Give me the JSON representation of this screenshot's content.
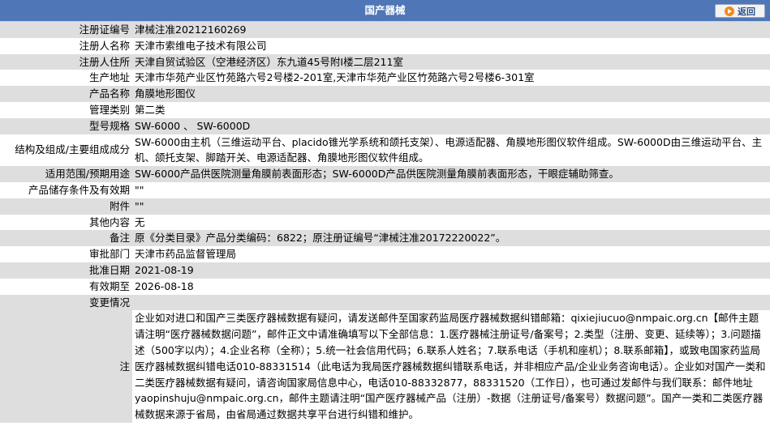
{
  "header": {
    "title": "国产器械",
    "back_label": "返回"
  },
  "rows": [
    {
      "label": "注册证编号",
      "value": "津械注准20212160269"
    },
    {
      "label": "注册人名称",
      "value": "天津市索维电子技术有限公司"
    },
    {
      "label": "注册人住所",
      "value": "天津自贸试验区（空港经济区）东九道45号附Ⅰ楼二层211室"
    },
    {
      "label": "生产地址",
      "value": "天津市华苑产业区竹苑路六号2号楼2-201室,天津市华苑产业区竹苑路六号2号楼6-301室"
    },
    {
      "label": "产品名称",
      "value": "角膜地形图仪"
    },
    {
      "label": "管理类别",
      "value": "第二类"
    },
    {
      "label": "型号规格",
      "value": "SW-6000 、 SW-6000D"
    },
    {
      "label": "结构及组成/主要组成成分",
      "value": "SW-6000由主机（三维运动平台、placido锥光学系统和颌托支架）、电源适配器、角膜地形图仪软件组成。SW-6000D由三维运动平台、主机、颌托支架、脚踏开关、电源适配器、角膜地形图仪软件组成。"
    },
    {
      "label": "适用范围/预期用途",
      "value": "SW-6000产品供医院测量角膜前表面形态；SW-6000D产品供医院测量角膜前表面形态，干眼症辅助筛查。"
    },
    {
      "label": "产品储存条件及有效期",
      "value": "\"\""
    },
    {
      "label": "附件",
      "value": "\"\""
    },
    {
      "label": "其他内容",
      "value": "无"
    },
    {
      "label": "备注",
      "value": "原《分类目录》产品分类编码：6822；原注册证编号“津械注准20172220022”。"
    },
    {
      "label": "审批部门",
      "value": "天津市药品监督管理局"
    },
    {
      "label": "批准日期",
      "value": "2021-08-19"
    },
    {
      "label": "有效期至",
      "value": "2026-08-18"
    },
    {
      "label": "变更情况",
      "value": ""
    }
  ],
  "note": {
    "label": "注",
    "value": "企业如对进口和国产三类医疗器械数据有疑问，请发送邮件至国家药监局医疗器械数据纠错邮箱：qixiejiucuo@nmpaic.org.cn【邮件主题请注明“医疗器械数据问题”，邮件正文中请准确填写以下全部信息：1.医疗器械注册证号/备案号；2.类型（注册、变更、延续等）；3.问题描述（500字以内）；4.企业名称（全称）；5.统一社会信用代码；6.联系人姓名；7.联系电话（手机和座机）；8.联系邮箱】，或致电国家药监局医疗器械数据纠错电话010-88331514（此电话为我局医疗器械数据纠错联系电话，并非相应产品/企业业务咨询电话）。企业如对国产一类和二类医疗器械数据有疑问，请咨询国家局信息中心，电话010-88332877，88331520（工作日），也可通过发邮件与我们联系：邮件地址yaopinshuju@nmpaic.org.cn，邮件主题请注明“国产医疗器械产品（注册）-数据（注册证号/备案号）数据问题”。国产一类和二类医疗器械数据来源于省局，由省局通过数据共享平台进行纠错和维护。"
  }
}
